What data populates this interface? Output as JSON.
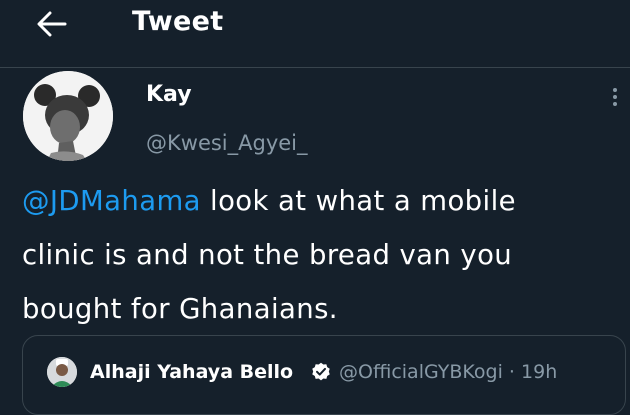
{
  "header": {
    "title": "Tweet",
    "back_icon": "arrow-left-icon"
  },
  "tweet": {
    "author_name": "Kay",
    "author_handle": "@Kwesi_Agyei_",
    "mention": "@JDMahama",
    "text_line1": " look at what a mobile",
    "text_line2": "clinic is and not the bread van you",
    "text_line3": "bought for Ghanaians.",
    "more_icon": "more-vertical-icon"
  },
  "quoted_tweet": {
    "author_name": "Alhaji Yahaya Bello",
    "author_handle": "@OfficialGYBKogi",
    "separator": "·",
    "time": "19h",
    "verified_icon": "verified-badge-icon"
  },
  "colors": {
    "background": "#15202b",
    "border": "#38444d",
    "text_primary": "#ffffff",
    "text_secondary": "#8899a6",
    "accent": "#1d9bf0"
  }
}
